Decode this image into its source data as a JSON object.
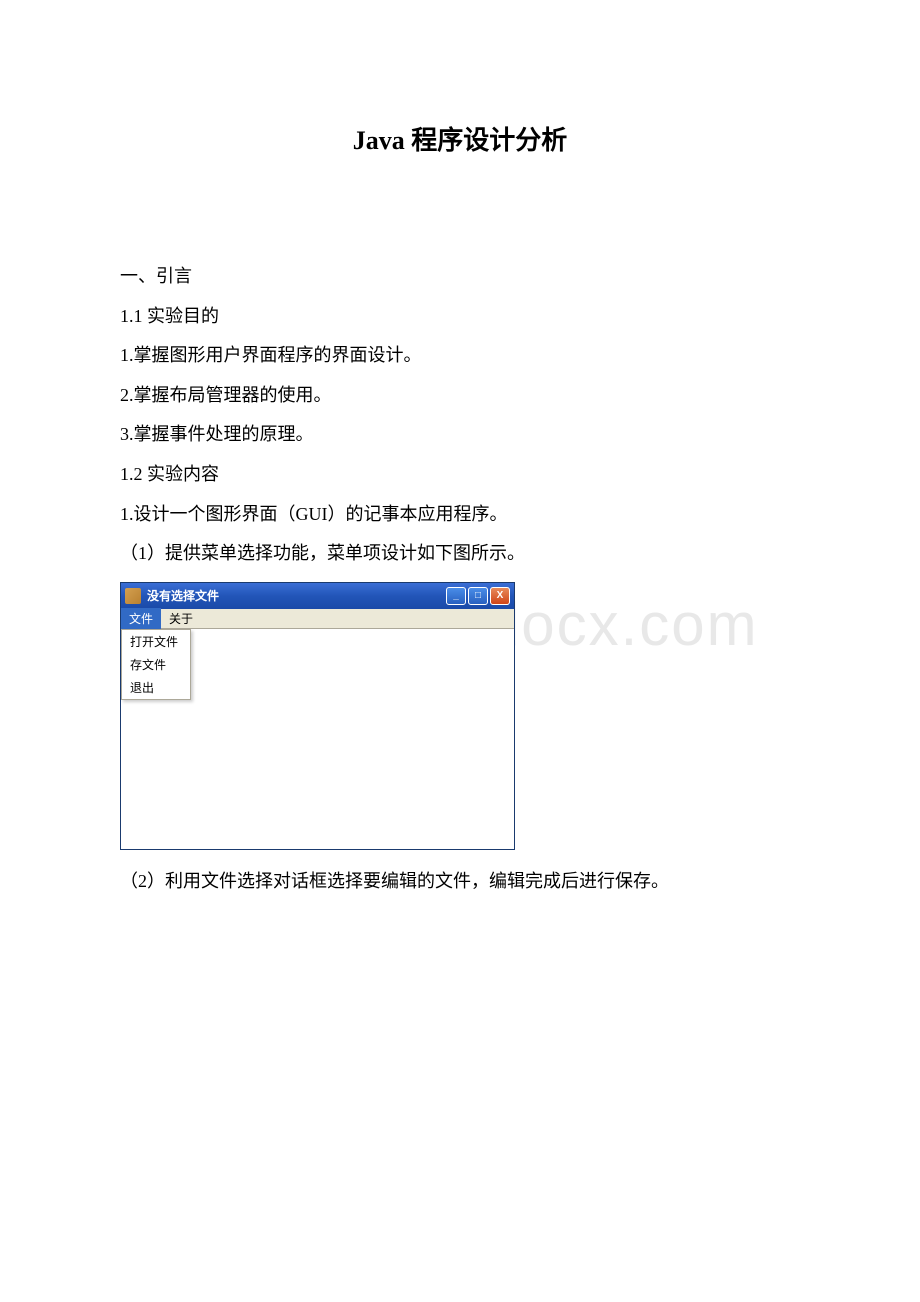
{
  "document": {
    "title": "Java 程序设计分析",
    "lines": [
      "一、引言",
      "1.1 实验目的",
      "1.掌握图形用户界面程序的界面设计。",
      "2.掌握布局管理器的使用。",
      "3.掌握事件处理的原理。",
      "1.2 实验内容",
      "1.设计一个图形界面（GUI）的记事本应用程序。",
      "（1）提供菜单选择功能，菜单项设计如下图所示。"
    ],
    "line_after": "（2）利用文件选择对话框选择要编辑的文件，编辑完成后进行保存。"
  },
  "app_window": {
    "title": "没有选择文件",
    "menubar": {
      "items": [
        "文件",
        "关于"
      ]
    },
    "dropdown": {
      "items": [
        "打开文件",
        "存文件",
        "退出"
      ]
    },
    "controls": {
      "minimize": "_",
      "maximize": "□",
      "close": "X"
    }
  },
  "watermark": "www.bdocx.com"
}
